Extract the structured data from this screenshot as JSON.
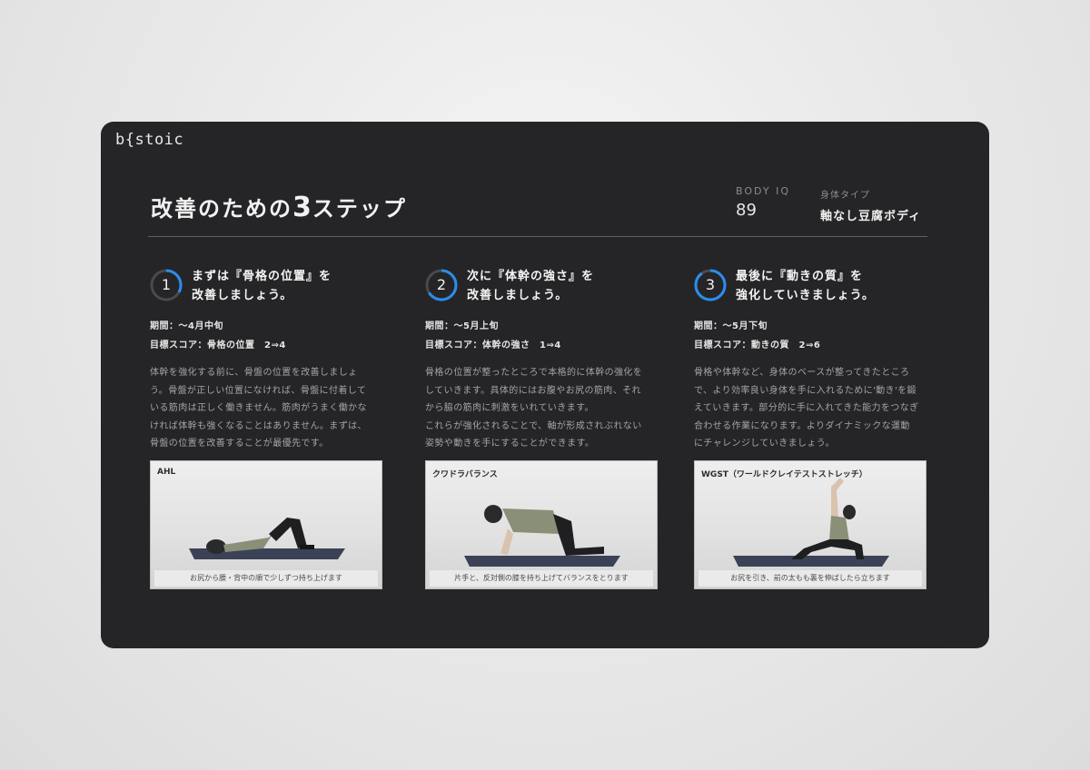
{
  "logo": "b{stoic",
  "page_title": {
    "prefix": "改善のための",
    "number": "3",
    "suffix": "ステップ"
  },
  "body_iq": {
    "label": "BODY IQ",
    "value": "89"
  },
  "body_type": {
    "label": "身体タイプ",
    "value": "軸なし豆腐ボディ"
  },
  "colors": {
    "background": "#252527",
    "accent": "#2a8df0",
    "ring_track": "#4a4a4d"
  },
  "steps": [
    {
      "number": "1",
      "progress": 0.33,
      "title_line1": "まずは『骨格の位置』を",
      "title_line2": "改善しましょう。",
      "period": "期間：～4月中旬",
      "target": "目標スコア：骨格の位置　2⇒4",
      "description": "体幹を強化する前に、骨盤の位置を改善しましょ\nう。骨盤が正しい位置になければ、骨盤に付着して\nいる筋肉は正しく働きません。筋肉がうまく働かな\nければ体幹も強くなることはありません。まずは、\n骨盤の位置を改善することが最優先です。",
      "photo_label": "AHL",
      "photo_caption": "お尻から腰・背中の順で少しずつ持ち上げます"
    },
    {
      "number": "2",
      "progress": 0.66,
      "title_line1": "次に『体幹の強さ』を",
      "title_line2": "改善しましょう。",
      "period": "期間：～5月上旬",
      "target": "目標スコア：体幹の強さ　1⇒4",
      "description": "骨格の位置が整ったところで本格的に体幹の強化を\nしていきます。具体的にはお腹やお尻の筋肉、それ\nから脇の筋肉に刺激をいれていきます。\nこれらが強化されることで、軸が形成されぶれない\n姿勢や動きを手にすることができます。",
      "photo_label": "クワドラバランス",
      "photo_caption": "片手と、反対側の膝を持ち上げてバランスをとります"
    },
    {
      "number": "3",
      "progress": 0.9,
      "title_line1": "最後に『動きの質』を",
      "title_line2": "強化していきましょう。",
      "period": "期間：～5月下旬",
      "target": "目標スコア：動きの質　2⇒6",
      "description": "骨格や体幹など、身体のベースが整ってきたところ\nで、より効率良い身体を手に入れるために'動き'を鍛\nえていきます。部分的に手に入れてきた能力をつなぎ\n合わせる作業になります。よりダイナミックな運動\nにチャレンジしていきましょう。",
      "photo_label": "WGST（ワールドクレイテストストレッチ）",
      "photo_caption": "お尻を引き、前の太もも裏を伸ばしたら立ちます"
    }
  ]
}
